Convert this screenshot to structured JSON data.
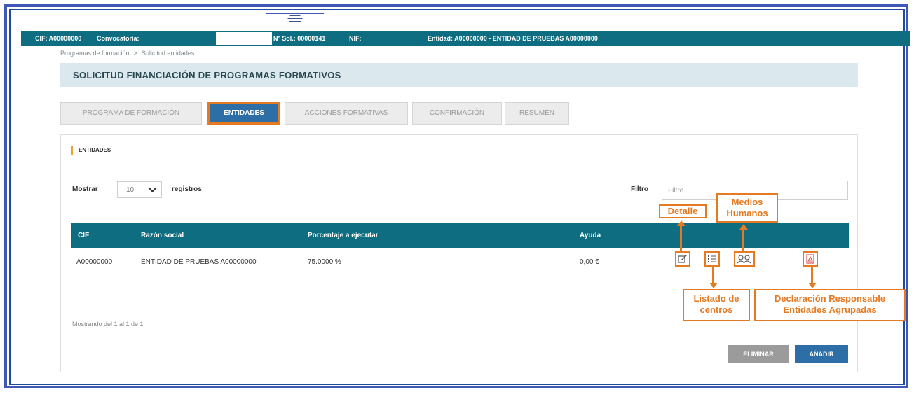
{
  "topbar": {
    "cif": "CIF: A00000000",
    "convocatoria": "Convocatoria:",
    "nsol": "Nº Sol.: 00000141",
    "nif": "NIF:",
    "entidad": "Entidad: A00000000 - ENTIDAD DE PRUEBAS A00000000"
  },
  "breadcrumb": {
    "item1": "Programas de formación",
    "separator": ">",
    "item2": "Solicitud entidades"
  },
  "page_title": "SOLICITUD FINANCIACIÓN DE PROGRAMAS FORMATIVOS",
  "tabs": [
    {
      "label": "PROGRAMA DE FORMACIÓN",
      "active": false
    },
    {
      "label": "ENTIDADES",
      "active": true
    },
    {
      "label": "ACCIONES FORMATIVAS",
      "active": false
    },
    {
      "label": "CONFIRMACIÓN",
      "active": false
    },
    {
      "label": "RESUMEN",
      "active": false
    }
  ],
  "section_title": "ENTIDADES",
  "length_control": {
    "mostrar_label": "Mostrar",
    "value": "10",
    "registros_label": "registros"
  },
  "filter": {
    "label": "Filtro",
    "placeholder": "Filtro..."
  },
  "table": {
    "headers": [
      "CIF",
      "Razón social",
      "Porcentaje a ejecutar",
      "Ayuda"
    ],
    "rows": [
      {
        "cif": "A00000000",
        "razon_social": "ENTIDAD DE PRUEBAS A00000000",
        "porcentaje": "75.0000 %",
        "ayuda": "0,00 €"
      }
    ]
  },
  "row_actions": {
    "detalle": "edit-icon",
    "listado": "list-icon",
    "medios": "users-icon",
    "declaracion": "pdf-icon"
  },
  "footer_info": "Mostrando del 1 al 1 de 1",
  "buttons": {
    "eliminar": "ELIMINAR",
    "anadir": "AÑADIR"
  },
  "callouts": {
    "detalle": "Detalle",
    "medios_line1": "Medios",
    "medios_line2": "Humanos",
    "listado_line1": "Listado de",
    "listado_line2": "centros",
    "declaracion_line1": "Declaración Responsable",
    "declaracion_line2": "Entidades Agrupadas"
  },
  "colors": {
    "teal": "#0e6d80",
    "accent_orange": "#e57a22",
    "primary_blue": "#2e6ea6",
    "frame_blue": "#3f57b5"
  }
}
